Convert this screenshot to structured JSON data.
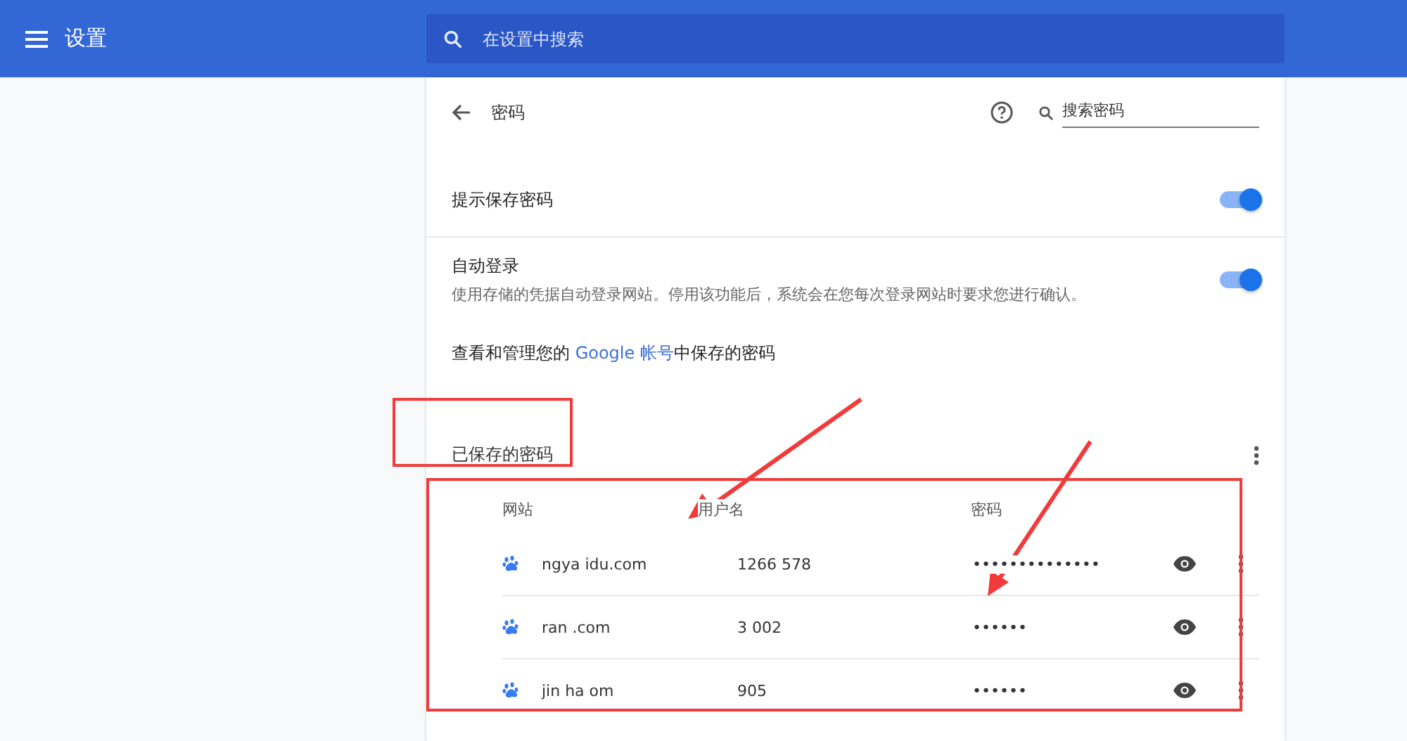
{
  "header": {
    "title": "设置",
    "search_placeholder": "在设置中搜索"
  },
  "page": {
    "title": "密码",
    "search_placeholder": "搜索密码"
  },
  "settings": [
    {
      "label": "提示保存密码",
      "on": true
    },
    {
      "label": "自动登录",
      "description": "使用存储的凭据自动登录网站。停用该功能后，系统会在您每次登录网站时要求您进行确认。",
      "on": true
    }
  ],
  "account_note": {
    "before": "查看和管理您的 ",
    "link": "Google 帐号",
    "after": "中保存的密码"
  },
  "saved": {
    "title": "已保存的密码",
    "columns": [
      "网站",
      "用户名",
      "密码"
    ],
    "rows": [
      {
        "site": "ngya idu.com",
        "username": "1266 578",
        "password": "••••••••••••••"
      },
      {
        "site": "ran .com",
        "username": "3 002",
        "password": "••••••"
      },
      {
        "site": "jin ha om",
        "username": "905",
        "password": "••••••"
      }
    ]
  }
}
